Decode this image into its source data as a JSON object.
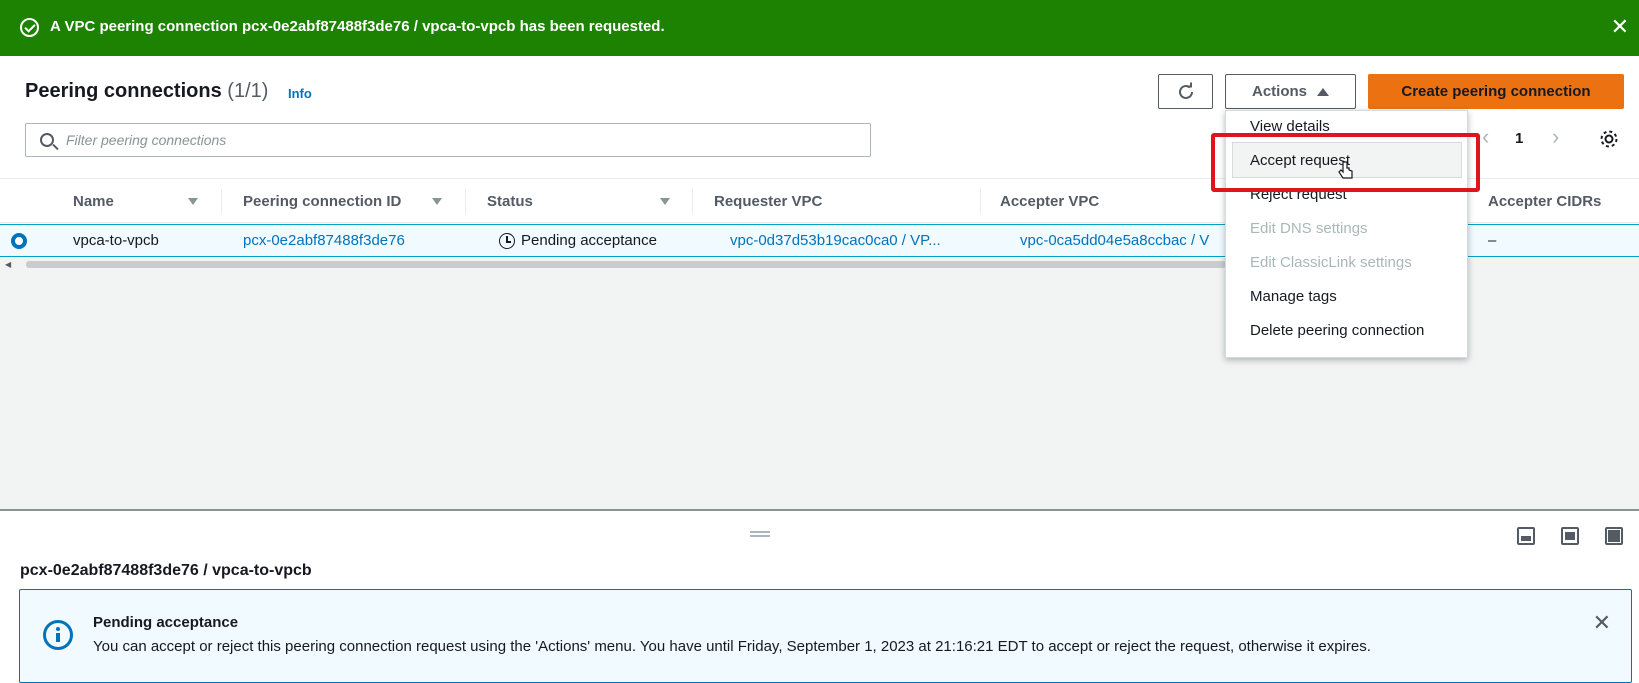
{
  "banner": {
    "message": "A VPC peering connection pcx-0e2abf87488f3de76 / vpca-to-vpcb has been requested.",
    "close_glyph": "✕"
  },
  "header": {
    "title": "Peering connections",
    "count": "(1/1)",
    "info_link": "Info",
    "actions_label": "Actions",
    "create_label": "Create peering connection"
  },
  "filter": {
    "placeholder": "Filter peering connections"
  },
  "pagination": {
    "prev": "‹",
    "page": "1",
    "next": "›"
  },
  "table": {
    "columns": [
      "Name",
      "Peering connection ID",
      "Status",
      "Requester VPC",
      "Accepter VPC",
      "Accepter CIDRs"
    ],
    "rows": [
      {
        "name": "vpca-to-vpcb",
        "peering_id": "pcx-0e2abf87488f3de76",
        "status": "Pending acceptance",
        "requester_vpc": "vpc-0d37d53b19cac0ca0 / VP...",
        "accepter_vpc": "vpc-0ca5dd04e5a8ccbac / V",
        "accepter_cidrs": "–"
      }
    ]
  },
  "actions_menu": {
    "items": [
      {
        "label": "View details",
        "disabled": false
      },
      {
        "label": "Accept request",
        "disabled": false
      },
      {
        "label": "Reject request",
        "disabled": false
      },
      {
        "label": "Edit DNS settings",
        "disabled": true
      },
      {
        "label": "Edit ClassicLink settings",
        "disabled": true
      },
      {
        "label": "Manage tags",
        "disabled": false
      },
      {
        "label": "Delete peering connection",
        "disabled": false
      }
    ]
  },
  "split_panel": {
    "title": "pcx-0e2abf87488f3de76 / vpca-to-vpcb",
    "alert_title": "Pending acceptance",
    "alert_body": "You can accept or reject this peering connection request using the 'Actions' menu. You have until Friday, September 1, 2023 at 21:16:21 EDT to accept or reject the request, otherwise it expires.",
    "alert_close": "✕"
  },
  "colors": {
    "success_banner": "#1d8102",
    "primary_button": "#ec7211",
    "link": "#0073bb",
    "highlight_box": "#e0141e"
  }
}
